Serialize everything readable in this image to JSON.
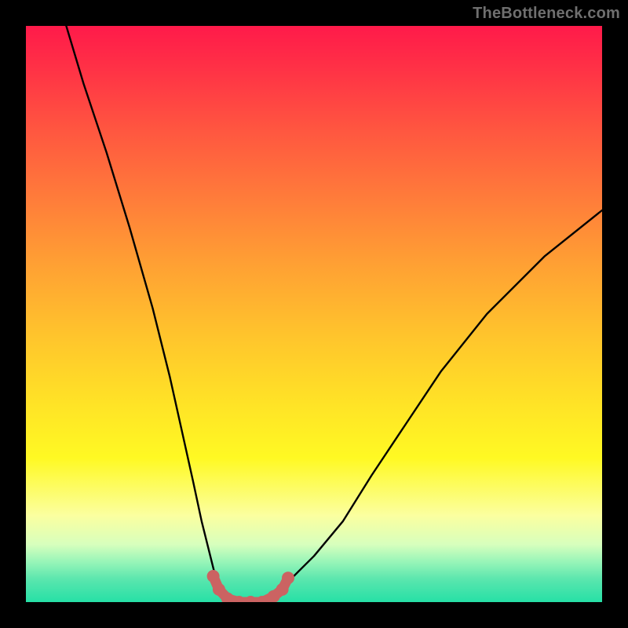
{
  "watermark": "TheBottleneck.com",
  "colors": {
    "curve": "#000000",
    "marker": "#cb6362",
    "background_black": "#000000"
  },
  "chart_data": {
    "type": "line",
    "title": "",
    "xlabel": "",
    "ylabel": "",
    "xlim": [
      0,
      100
    ],
    "ylim": [
      0,
      100
    ],
    "grid": false,
    "series": [
      {
        "name": "bottleneck-curve",
        "x": [
          7,
          10,
          14,
          18,
          22,
          25,
          27,
          29,
          30.5,
          32,
          33,
          34.5,
          36,
          37.5,
          40,
          43,
          46,
          50,
          55,
          60,
          66,
          72,
          80,
          90,
          100
        ],
        "y": [
          100,
          90,
          78,
          65,
          51,
          39,
          30,
          21,
          14,
          8,
          4,
          1,
          0,
          0,
          0,
          1.5,
          4,
          8,
          14,
          22,
          31,
          40,
          50,
          60,
          68
        ]
      }
    ],
    "markers": {
      "name": "highlight-dots",
      "color": "#cb6362",
      "x": [
        32.5,
        33.5,
        35,
        37,
        39,
        41,
        43,
        44.5,
        45.5
      ],
      "y": [
        4.5,
        2.2,
        0.6,
        0,
        0,
        0,
        1,
        2.2,
        4.2
      ]
    }
  }
}
